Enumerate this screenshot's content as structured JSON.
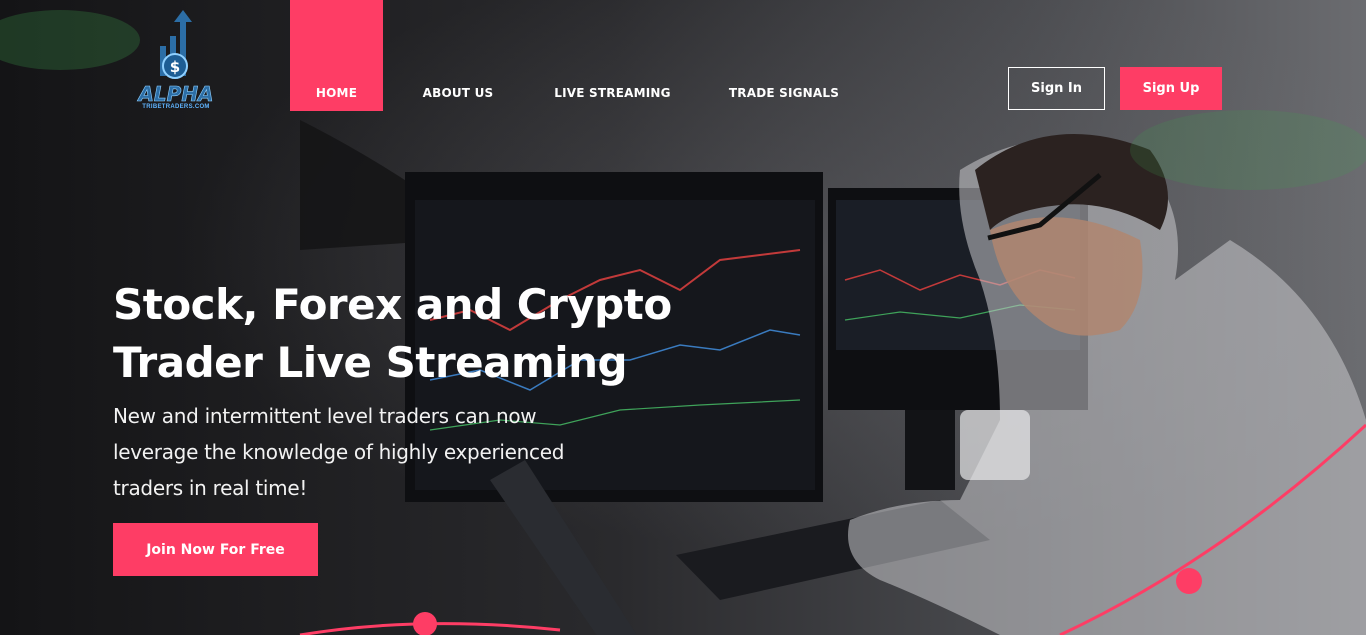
{
  "brand": {
    "logo_text": "ALPHA",
    "logo_subtext": "TRIBETRADERS.COM"
  },
  "nav": {
    "items": [
      {
        "label": "HOME",
        "active": true
      },
      {
        "label": "ABOUT US",
        "active": false
      },
      {
        "label": "LIVE STREAMING",
        "active": false
      },
      {
        "label": "TRADE SIGNALS",
        "active": false
      }
    ]
  },
  "auth": {
    "sign_in_label": "Sign In",
    "sign_up_label": "Sign Up"
  },
  "hero": {
    "headline_line1": "Stock, Forex and Crypto",
    "headline_line2": "Trader Live Streaming",
    "subtext_line1": "New and intermittent level traders can now",
    "subtext_line2": "leverage the knowledge of highly experienced",
    "subtext_line3": "traders in real time!",
    "cta_label": "Join Now For Free",
    "background_image": "trader-at-desk-with-monitors"
  },
  "colors": {
    "accent": "#fe3d65",
    "text": "#ffffff",
    "logo_blue": "#2c6ea6"
  }
}
